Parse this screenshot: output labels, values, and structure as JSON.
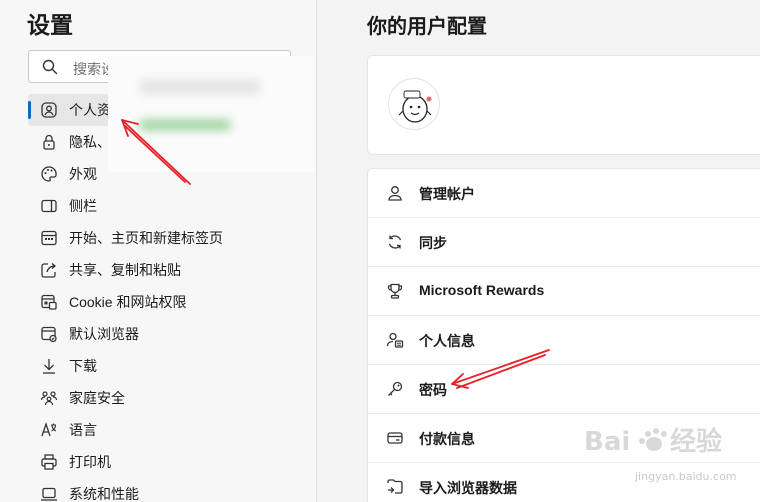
{
  "sidebar": {
    "title": "设置",
    "search_placeholder": "搜索设置",
    "items": [
      {
        "label": "个人资料",
        "icon": "profile-icon",
        "active": true
      },
      {
        "label": "隐私、搜索和服务",
        "icon": "lock-icon"
      },
      {
        "label": "外观",
        "icon": "palette-icon"
      },
      {
        "label": "侧栏",
        "icon": "sidebar-icon"
      },
      {
        "label": "开始、主页和新建标签页",
        "icon": "home-grid-icon"
      },
      {
        "label": "共享、复制和粘贴",
        "icon": "share-icon"
      },
      {
        "label": "Cookie 和网站权限",
        "icon": "cookie-icon"
      },
      {
        "label": "默认浏览器",
        "icon": "browser-icon"
      },
      {
        "label": "下载",
        "icon": "download-icon"
      },
      {
        "label": "家庭安全",
        "icon": "family-icon"
      },
      {
        "label": "语言",
        "icon": "language-icon"
      },
      {
        "label": "打印机",
        "icon": "printer-icon"
      },
      {
        "label": "系统和性能",
        "icon": "laptop-icon"
      }
    ]
  },
  "main": {
    "title": "你的用户配置",
    "profile_card": {
      "avatar_icon": "avatar-sticker-icon"
    },
    "rows": [
      {
        "label": "管理帐户",
        "icon": "person-icon"
      },
      {
        "label": "同步",
        "icon": "sync-icon"
      },
      {
        "label": "Microsoft Rewards",
        "icon": "trophy-icon"
      },
      {
        "label": "个人信息",
        "icon": "personal-info-icon"
      },
      {
        "label": "密码",
        "icon": "key-icon"
      },
      {
        "label": "付款信息",
        "icon": "card-icon"
      },
      {
        "label": "导入浏览器数据",
        "icon": "import-icon"
      }
    ]
  },
  "annotation_color": "#e8202a",
  "accent_color": "#0f6cbd",
  "watermark": {
    "text": "jingyan.baidu.com"
  }
}
